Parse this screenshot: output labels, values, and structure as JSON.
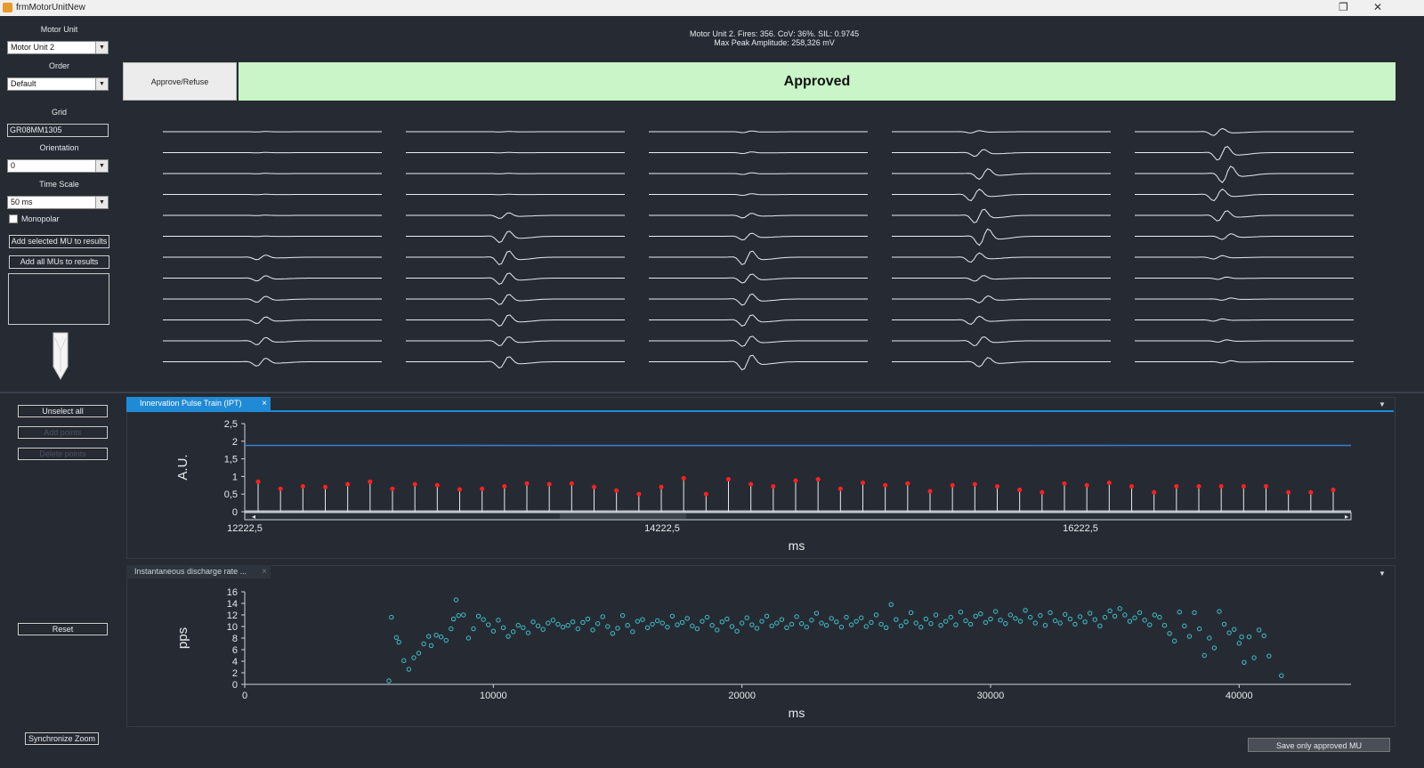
{
  "window": {
    "title": "frmMotorUnitNew"
  },
  "left_panel": {
    "motor_unit_label": "Motor Unit",
    "motor_unit_value": "Motor Unit 2",
    "order_label": "Order",
    "order_value": "Default",
    "grid_label": "Grid",
    "grid_value": "GR08MM1305",
    "orientation_label": "Orientation",
    "orientation_value": "0",
    "time_scale_label": "Time Scale",
    "time_scale_value": "50 ms",
    "monopolar_label": "Monopolar",
    "add_selected_label": "Add selected MU to results",
    "add_all_label": "Add all MUs to results"
  },
  "header": {
    "info_line1": "Motor Unit 2. Fires: 356. CoV: 36%. SIL: 0.9745",
    "info_line2": "Max Peak Amplitude: 258,326 mV",
    "approve_button": "Approve/Refuse",
    "status": "Approved",
    "status_color": "#c9f5c8"
  },
  "controls": {
    "unselect_all": "Unselect all",
    "add_points": "Add points",
    "delete_points": "Delete points",
    "reset": "Reset",
    "synchronize_zoom": "Synchronize Zoom",
    "save_approved": "Save only approved MU"
  },
  "ipt_panel": {
    "tab_label": "Innervation Pulse Train (IPT)",
    "close_glyph": "×"
  },
  "idr_panel": {
    "tab_label": "Instantaneous discharge rate ...",
    "close_glyph": "×"
  },
  "chart_data": [
    {
      "type": "line",
      "name": "ipt",
      "ylabel": "A.U.",
      "xlabel": "ms",
      "y_ticks": [
        "2,5",
        "2",
        "1,5",
        "1",
        "0,5",
        "0"
      ],
      "x_tick_labels": [
        "12222,5",
        "14222,5",
        "16222,5"
      ],
      "ylim": [
        0,
        2.5
      ],
      "threshold_line": 1.88,
      "spike_color": "#ff2020",
      "line_color": "#3a7fd0",
      "spike_peaks": [
        0.85,
        0.65,
        0.72,
        0.7,
        0.78,
        0.85,
        0.65,
        0.78,
        0.75,
        0.63,
        0.65,
        0.72,
        0.8,
        0.78,
        0.8,
        0.7,
        0.6,
        0.5,
        0.7,
        0.95,
        0.5,
        0.92,
        0.78,
        0.72,
        0.88,
        0.92,
        0.65,
        0.82,
        0.75,
        0.8,
        0.58,
        0.75,
        0.78,
        0.72,
        0.62,
        0.55,
        0.8,
        0.75,
        0.82,
        0.72,
        0.55,
        0.72,
        0.72,
        0.72,
        0.72,
        0.72,
        0.55,
        0.55,
        0.62
      ]
    },
    {
      "type": "scatter",
      "name": "instantaneous-discharge-rate",
      "ylabel": "pps",
      "xlabel": "ms",
      "xlim": [
        0,
        44500
      ],
      "ylim": [
        0,
        16
      ],
      "x_ticks": [
        0,
        10000,
        20000,
        30000,
        40000
      ],
      "y_ticks": [
        0,
        2,
        4,
        6,
        8,
        10,
        12,
        14,
        16
      ],
      "point_color": "#3fc1c9",
      "points": [
        [
          5800,
          0.6
        ],
        [
          5900,
          11.6
        ],
        [
          6100,
          8.1
        ],
        [
          6200,
          7.3
        ],
        [
          6400,
          4.1
        ],
        [
          6600,
          2.6
        ],
        [
          6800,
          4.6
        ],
        [
          7000,
          5.4
        ],
        [
          7200,
          7.0
        ],
        [
          7400,
          8.3
        ],
        [
          7500,
          6.7
        ],
        [
          7700,
          8.5
        ],
        [
          7900,
          8.2
        ],
        [
          8100,
          7.6
        ],
        [
          8300,
          9.6
        ],
        [
          8400,
          11.3
        ],
        [
          8500,
          14.6
        ],
        [
          8600,
          11.9
        ],
        [
          8800,
          12.0
        ],
        [
          9000,
          8.0
        ],
        [
          9200,
          9.6
        ],
        [
          9400,
          11.8
        ],
        [
          9600,
          11.2
        ],
        [
          9800,
          10.3
        ],
        [
          10000,
          9.2
        ],
        [
          10200,
          11.1
        ],
        [
          10400,
          9.8
        ],
        [
          10600,
          8.3
        ],
        [
          10800,
          9.1
        ],
        [
          11000,
          10.2
        ],
        [
          11200,
          9.8
        ],
        [
          11400,
          8.9
        ],
        [
          11600,
          10.8
        ],
        [
          11800,
          10.1
        ],
        [
          12000,
          9.5
        ],
        [
          12200,
          10.6
        ],
        [
          12400,
          11.1
        ],
        [
          12600,
          10.4
        ],
        [
          12800,
          9.9
        ],
        [
          13000,
          10.2
        ],
        [
          13200,
          10.8
        ],
        [
          13400,
          9.6
        ],
        [
          13600,
          10.7
        ],
        [
          13800,
          11.3
        ],
        [
          14000,
          9.4
        ],
        [
          14200,
          10.5
        ],
        [
          14400,
          11.7
        ],
        [
          14600,
          10.0
        ],
        [
          14800,
          8.8
        ],
        [
          15000,
          9.7
        ],
        [
          15200,
          11.9
        ],
        [
          15400,
          10.2
        ],
        [
          15600,
          9.1
        ],
        [
          15800,
          10.9
        ],
        [
          16000,
          11.2
        ],
        [
          16200,
          9.8
        ],
        [
          16400,
          10.4
        ],
        [
          16600,
          11.0
        ],
        [
          16800,
          10.6
        ],
        [
          17000,
          9.9
        ],
        [
          17200,
          11.8
        ],
        [
          17400,
          10.3
        ],
        [
          17600,
          10.7
        ],
        [
          17800,
          11.4
        ],
        [
          18000,
          10.1
        ],
        [
          18200,
          9.6
        ],
        [
          18400,
          10.9
        ],
        [
          18600,
          11.6
        ],
        [
          18800,
          10.2
        ],
        [
          19000,
          9.4
        ],
        [
          19200,
          10.8
        ],
        [
          19400,
          11.3
        ],
        [
          19600,
          10.0
        ],
        [
          19800,
          9.2
        ],
        [
          20000,
          10.6
        ],
        [
          20200,
          11.5
        ],
        [
          20400,
          10.3
        ],
        [
          20600,
          9.7
        ],
        [
          20800,
          10.9
        ],
        [
          21000,
          11.8
        ],
        [
          21200,
          10.1
        ],
        [
          21400,
          10.6
        ],
        [
          21600,
          11.2
        ],
        [
          21800,
          9.8
        ],
        [
          22000,
          10.4
        ],
        [
          22200,
          11.7
        ],
        [
          22400,
          10.5
        ],
        [
          22600,
          9.9
        ],
        [
          22800,
          11.1
        ],
        [
          23000,
          12.3
        ],
        [
          23200,
          10.6
        ],
        [
          23400,
          10.2
        ],
        [
          23600,
          11.4
        ],
        [
          23800,
          10.8
        ],
        [
          24000,
          9.9
        ],
        [
          24200,
          11.6
        ],
        [
          24400,
          10.3
        ],
        [
          24600,
          10.9
        ],
        [
          24800,
          11.5
        ],
        [
          25000,
          10.0
        ],
        [
          25200,
          10.7
        ],
        [
          25400,
          12.0
        ],
        [
          25600,
          10.4
        ],
        [
          25800,
          9.8
        ],
        [
          26000,
          13.8
        ],
        [
          26200,
          11.2
        ],
        [
          26400,
          10.1
        ],
        [
          26600,
          10.8
        ],
        [
          26800,
          12.4
        ],
        [
          27000,
          10.6
        ],
        [
          27200,
          9.9
        ],
        [
          27400,
          11.3
        ],
        [
          27600,
          10.5
        ],
        [
          27800,
          12.0
        ],
        [
          28000,
          10.2
        ],
        [
          28200,
          10.9
        ],
        [
          28400,
          11.6
        ],
        [
          28600,
          10.3
        ],
        [
          28800,
          12.5
        ],
        [
          29000,
          11.0
        ],
        [
          29200,
          10.4
        ],
        [
          29400,
          11.8
        ],
        [
          29600,
          12.2
        ],
        [
          29800,
          10.7
        ],
        [
          30000,
          11.3
        ],
        [
          30200,
          12.6
        ],
        [
          30400,
          11.1
        ],
        [
          30600,
          10.5
        ],
        [
          30800,
          12.0
        ],
        [
          31000,
          11.4
        ],
        [
          31200,
          10.9
        ],
        [
          31400,
          12.8
        ],
        [
          31600,
          11.6
        ],
        [
          31800,
          10.6
        ],
        [
          32000,
          11.9
        ],
        [
          32200,
          10.2
        ],
        [
          32400,
          12.4
        ],
        [
          32600,
          11.0
        ],
        [
          32800,
          10.6
        ],
        [
          33000,
          12.1
        ],
        [
          33200,
          11.3
        ],
        [
          33400,
          10.4
        ],
        [
          33600,
          11.7
        ],
        [
          33800,
          10.8
        ],
        [
          34000,
          12.3
        ],
        [
          34200,
          11.2
        ],
        [
          34400,
          10.1
        ],
        [
          34600,
          11.6
        ],
        [
          34800,
          12.7
        ],
        [
          35000,
          11.8
        ],
        [
          35200,
          13.1
        ],
        [
          35400,
          12.0
        ],
        [
          35600,
          10.9
        ],
        [
          35800,
          11.5
        ],
        [
          36000,
          12.4
        ],
        [
          36200,
          11.1
        ],
        [
          36400,
          10.3
        ],
        [
          36600,
          12.0
        ],
        [
          36800,
          11.6
        ],
        [
          37000,
          10.2
        ],
        [
          37200,
          8.8
        ],
        [
          37400,
          7.5
        ],
        [
          37600,
          12.5
        ],
        [
          37800,
          10.1
        ],
        [
          38000,
          8.3
        ],
        [
          38200,
          12.4
        ],
        [
          38400,
          9.6
        ],
        [
          38600,
          5.0
        ],
        [
          38800,
          8.0
        ],
        [
          39000,
          6.3
        ],
        [
          39200,
          12.6
        ],
        [
          39400,
          10.4
        ],
        [
          39600,
          8.9
        ],
        [
          39800,
          9.5
        ],
        [
          40000,
          7.1
        ],
        [
          40100,
          8.2
        ],
        [
          40200,
          3.8
        ],
        [
          40400,
          8.2
        ],
        [
          40600,
          4.6
        ],
        [
          40800,
          9.4
        ],
        [
          41000,
          8.4
        ],
        [
          41200,
          4.9
        ],
        [
          41700,
          1.5
        ]
      ]
    }
  ]
}
